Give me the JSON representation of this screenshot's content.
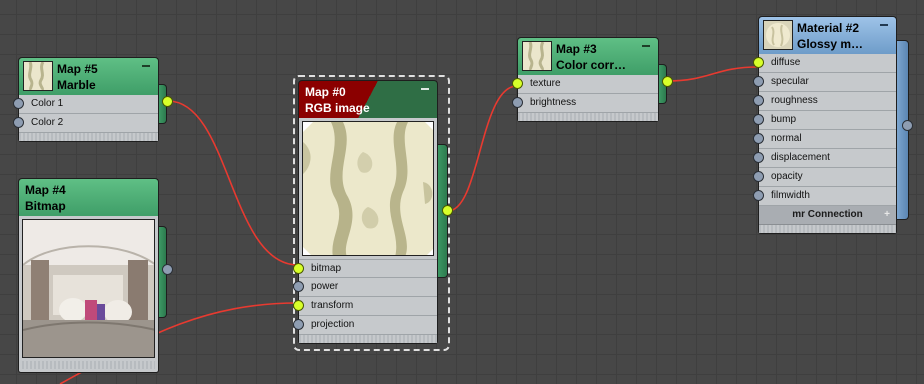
{
  "nodes": {
    "map5": {
      "title": "Map #5",
      "subtitle": "Marble",
      "inputs": [
        "Color 1",
        "Color 2"
      ]
    },
    "map4": {
      "title": "Map #4",
      "subtitle": "Bitmap"
    },
    "map0": {
      "title": "Map #0",
      "subtitle": "RGB image",
      "inputs": [
        "bitmap",
        "power",
        "transform",
        "projection"
      ]
    },
    "map3": {
      "title": "Map #3",
      "subtitle": "Color corr…",
      "inputs": [
        "texture",
        "brightness"
      ]
    },
    "material2": {
      "title": "Material #2",
      "subtitle": "Glossy m…",
      "inputs": [
        "diffuse",
        "specular",
        "roughness",
        "bump",
        "normal",
        "displacement",
        "opacity",
        "filmwidth"
      ],
      "footer": "mr Connection"
    }
  },
  "colors": {
    "wire": "#e83a30",
    "socket_active": "#d8ff2a",
    "socket_idle": "#8e9db2",
    "header_map": "#4fae78",
    "header_material": "#8cb4de",
    "header_selected": "#8b0000",
    "canvas": "#474747"
  }
}
